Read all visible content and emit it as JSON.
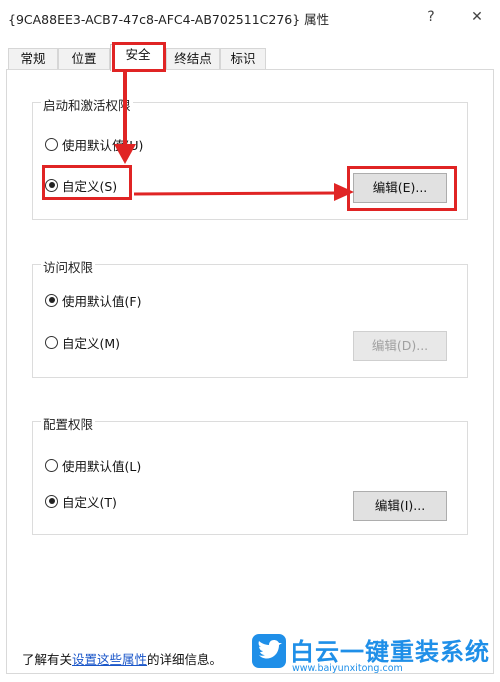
{
  "window": {
    "title": "{9CA88EE3-ACB7-47c8-AFC4-AB702511C276} 属性",
    "help_glyph": "?",
    "close_glyph": "✕"
  },
  "tabs": [
    {
      "label": "常规",
      "active": false
    },
    {
      "label": "位置",
      "active": false
    },
    {
      "label": "安全",
      "active": true
    },
    {
      "label": "终结点",
      "active": false
    },
    {
      "label": "标识",
      "active": false
    }
  ],
  "groups": {
    "launch": {
      "title": "启动和激活权限",
      "option_default": "使用默认值(U)",
      "option_custom": "自定义(S)",
      "selected": "custom",
      "edit_label": "编辑(E)...",
      "edit_enabled": true
    },
    "access": {
      "title": "访问权限",
      "option_default": "使用默认值(F)",
      "option_custom": "自定义(M)",
      "selected": "default",
      "edit_label": "编辑(D)...",
      "edit_enabled": false
    },
    "config": {
      "title": "配置权限",
      "option_default": "使用默认值(L)",
      "option_custom": "自定义(T)",
      "selected": "custom",
      "edit_label": "编辑(I)...",
      "edit_enabled": true
    }
  },
  "footer": {
    "prefix": "了解有关",
    "link": "设置这些属性",
    "suffix": "的详细信息。"
  },
  "watermark": {
    "name": "白云一键重装系统",
    "url": "www.baiyunxitong.com"
  },
  "colors": {
    "highlight_red": "#e02424",
    "link_blue": "#1a56c9",
    "brand_blue": "#1f8fe8"
  },
  "icons": [
    "help-icon",
    "close-icon",
    "bird-logo-icon"
  ]
}
